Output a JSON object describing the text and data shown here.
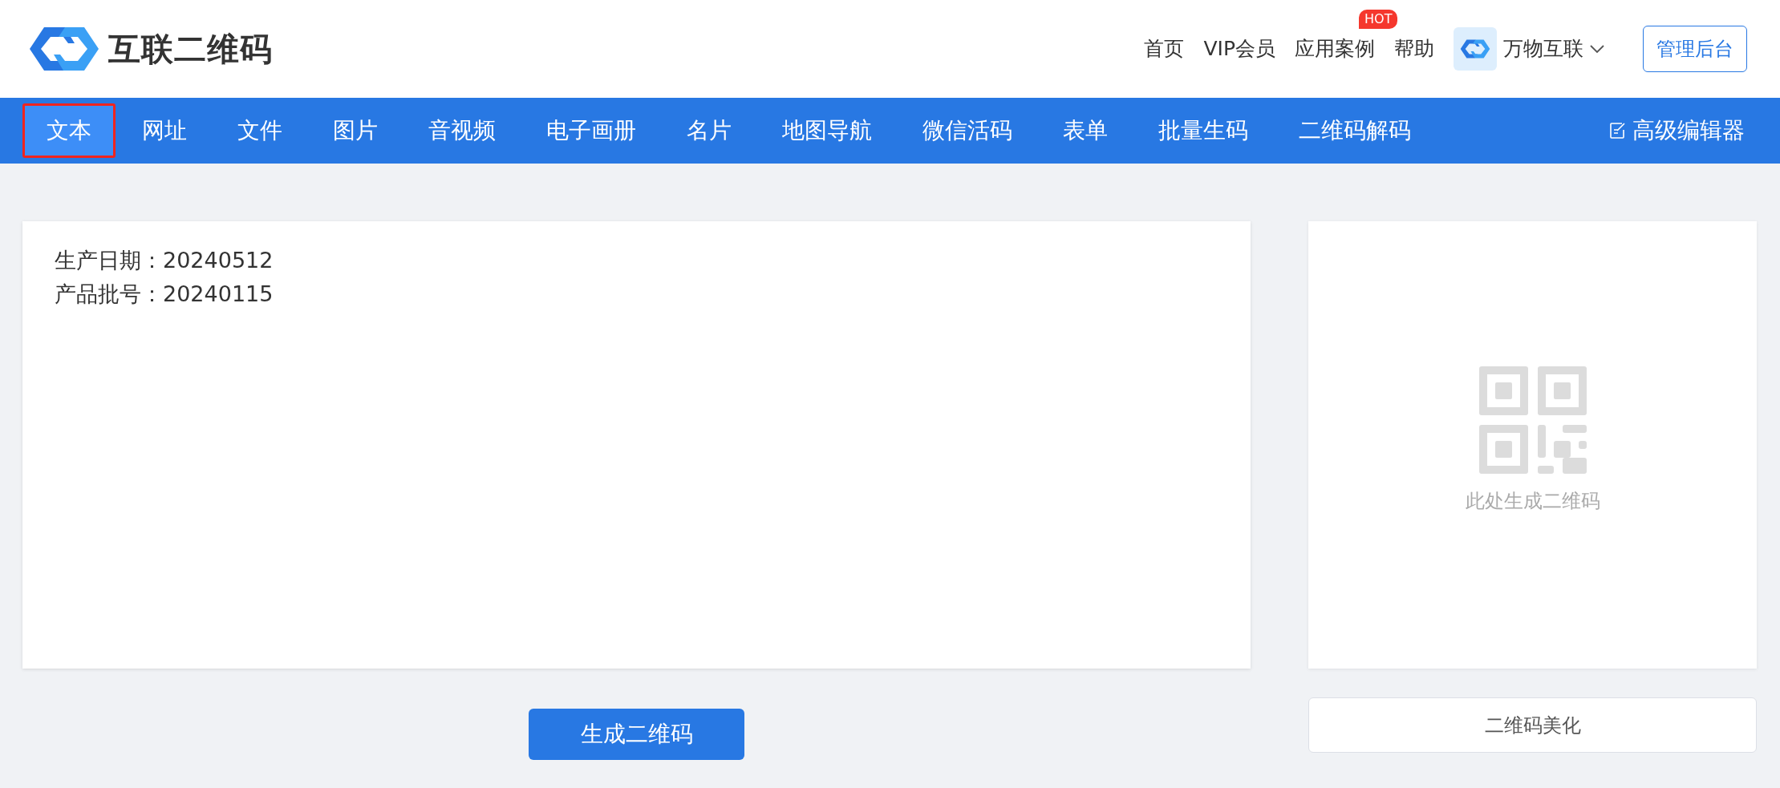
{
  "logo": {
    "text": "互联二维码"
  },
  "top_nav": [
    {
      "label": "首页"
    },
    {
      "label": "VIP会员"
    },
    {
      "label": "应用案例",
      "badge": "HOT"
    },
    {
      "label": "帮助"
    }
  ],
  "account": {
    "name": "万物互联"
  },
  "admin_button": "管理后台",
  "tabs": [
    {
      "label": "文本",
      "selected": true
    },
    {
      "label": "网址",
      "selected": false
    },
    {
      "label": "文件",
      "selected": false
    },
    {
      "label": "图片",
      "selected": false
    },
    {
      "label": "音视频",
      "selected": false
    },
    {
      "label": "电子画册",
      "selected": false
    },
    {
      "label": "名片",
      "selected": false
    },
    {
      "label": "地图导航",
      "selected": false
    },
    {
      "label": "微信活码",
      "selected": false
    },
    {
      "label": "表单",
      "selected": false
    },
    {
      "label": "批量生码",
      "selected": false
    },
    {
      "label": "二维码解码",
      "selected": false
    }
  ],
  "advanced_editor": "高级编辑器",
  "editor": {
    "value": "生产日期：20240512\n产品批号：20240115"
  },
  "preview": {
    "text": "此处生成二维码"
  },
  "generate_button": "生成二维码",
  "beautify_button": "二维码美化"
}
